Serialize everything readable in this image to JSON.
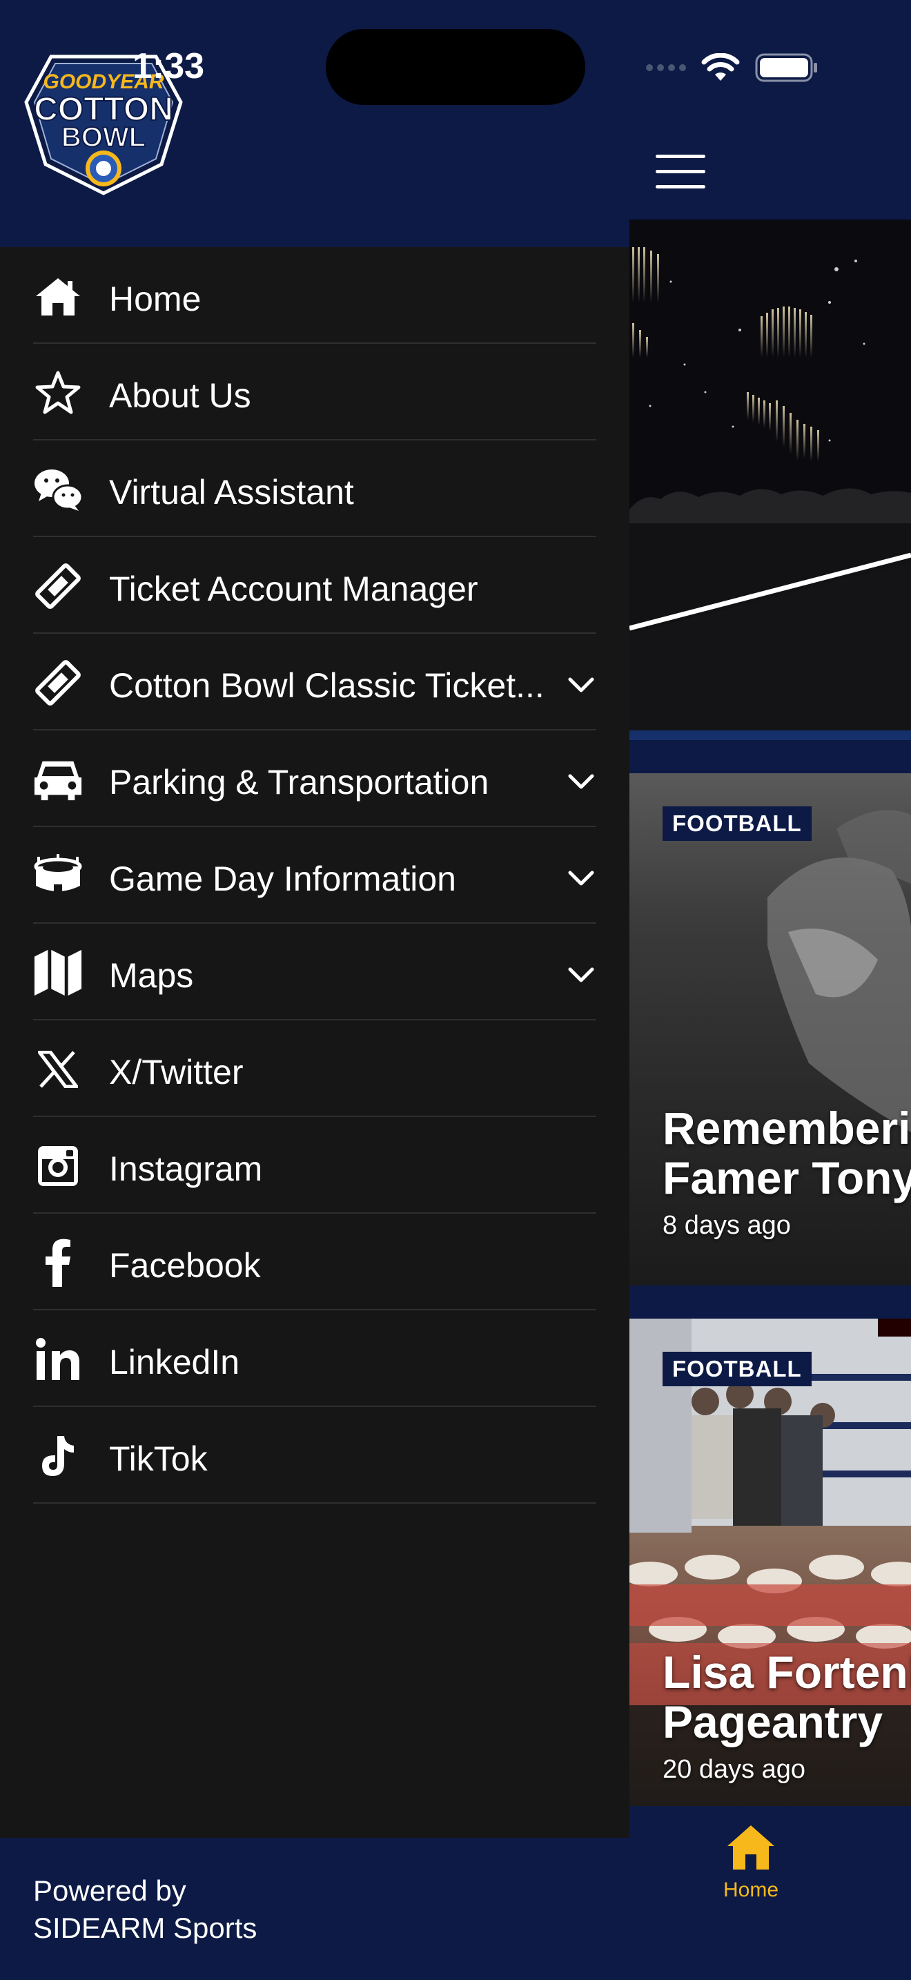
{
  "status_bar": {
    "time": "1:33"
  },
  "drawer": {
    "logo": {
      "name": "cotton-bowl-logo",
      "brand_line": "GOODYEAR",
      "line1": "COTTON",
      "line2": "BOWL"
    },
    "menu": [
      {
        "label": "Home",
        "icon": "home-icon",
        "has_chevron": false
      },
      {
        "label": "About Us",
        "icon": "star-icon",
        "has_chevron": false
      },
      {
        "label": "Virtual Assistant",
        "icon": "chat-icon",
        "has_chevron": false
      },
      {
        "label": "Ticket Account Manager",
        "icon": "ticket-icon",
        "has_chevron": false
      },
      {
        "label": "Cotton Bowl Classic Ticket...",
        "icon": "ticket-icon",
        "has_chevron": true
      },
      {
        "label": "Parking & Transportation",
        "icon": "car-icon",
        "has_chevron": true
      },
      {
        "label": "Game Day Information",
        "icon": "stadium-icon",
        "has_chevron": true
      },
      {
        "label": "Maps",
        "icon": "map-icon",
        "has_chevron": true
      },
      {
        "label": "X/Twitter",
        "icon": "x-twitter-icon",
        "has_chevron": false
      },
      {
        "label": "Instagram",
        "icon": "instagram-icon",
        "has_chevron": false
      },
      {
        "label": "Facebook",
        "icon": "facebook-icon",
        "has_chevron": false
      },
      {
        "label": "LinkedIn",
        "icon": "linkedin-icon",
        "has_chevron": false
      },
      {
        "label": "TikTok",
        "icon": "tiktok-icon",
        "has_chevron": false
      }
    ],
    "footer": {
      "line1": "Powered by",
      "line2": "SIDEARM Sports"
    }
  },
  "app": {
    "stories": [
      {
        "tag": "FOOTBALL",
        "title": "Rememberi\nFamer Tony",
        "date": "8 days ago"
      },
      {
        "tag": "FOOTBALL",
        "title": "Lisa Fortenl\nPageantry",
        "date": "20 days ago"
      }
    ],
    "tabbar": {
      "home_label": "Home",
      "active_color": "#f6b81b"
    }
  },
  "colors": {
    "navy": "#0c1a45",
    "drawer_bg": "#161616",
    "accent_gold": "#f6b81b"
  }
}
